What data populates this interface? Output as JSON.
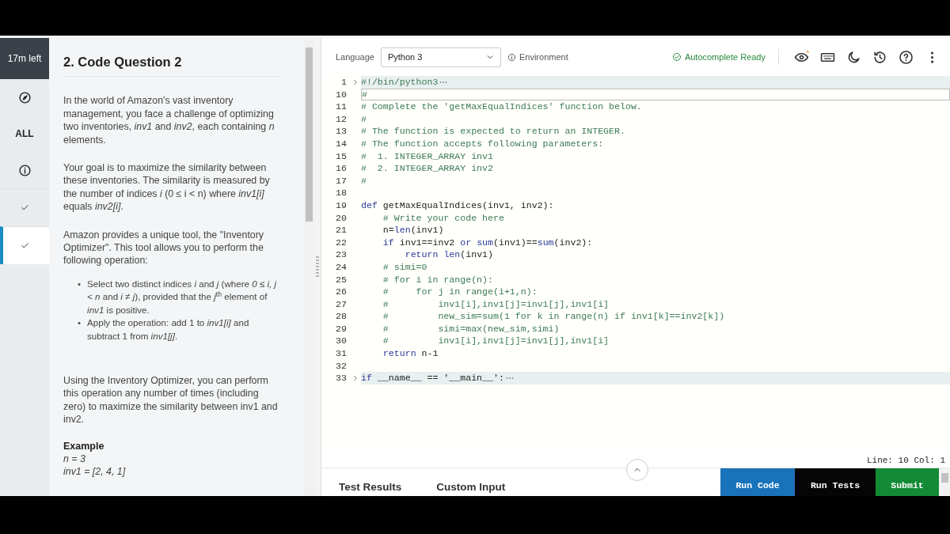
{
  "timer": "17m left",
  "nav": [
    {
      "kind": "compass",
      "selected": false
    },
    {
      "kind": "text",
      "label": "ALL",
      "selected": false
    },
    {
      "kind": "info",
      "selected": false
    },
    {
      "kind": "check",
      "selected": false
    },
    {
      "kind": "check",
      "selected": true
    }
  ],
  "question": {
    "title": "2. Code Question 2",
    "blocks": [
      {
        "kind": "para",
        "text": "In the world of Amazon's vast inventory management, you face a challenge of optimizing two inventories, *inv1* and *inv2*, each containing *n* elements."
      },
      {
        "kind": "para",
        "text": "Your goal is to maximize the similarity between these inventories. The similarity is measured by the number of indices *i* (0 ≤ i < n) where *inv1[i]* equals *inv2[i]*."
      },
      {
        "kind": "para",
        "text": "Amazon provides a unique tool, the \"Inventory Optimizer\". This tool allows you to perform the following operation:"
      },
      {
        "kind": "bullets",
        "items": [
          {
            "marker": "•",
            "text": "Select two distinct indices *i* and *j* (where *0 ≤ i, j < n* and *i ≠ j*), provided that the *j*$^{th}$ element of *inv1* is positive."
          },
          {
            "marker": "•",
            "text": "Apply the operation: add 1 to *inv1[i]* and subtract 1 from *inv1[j]*."
          }
        ]
      },
      {
        "kind": "gap"
      },
      {
        "kind": "para",
        "text": "Using the Inventory Optimizer, you can perform this operation any number of times (including zero) to maximize the similarity between inv1 and inv2."
      },
      {
        "kind": "heading",
        "text": "Example"
      },
      {
        "kind": "example",
        "text": "n = 3"
      },
      {
        "kind": "example",
        "text": "inv1 = [2, 4, 1]"
      }
    ]
  },
  "editor": {
    "language_label": "Language",
    "language": "Python 3",
    "environment": "Environment",
    "autocomplete": "Autocomplete Ready",
    "lines": [
      {
        "num": "1",
        "kind": "comment",
        "text": "#!/bin/python3",
        "folded": true,
        "current": false
      },
      {
        "num": "10",
        "kind": "comment",
        "text": "#",
        "folded": false,
        "current": true
      },
      {
        "num": "11",
        "kind": "comment",
        "text": "# Complete the 'getMaxEqualIndices' function below.",
        "folded": false,
        "current": false
      },
      {
        "num": "12",
        "kind": "comment",
        "text": "#",
        "folded": false,
        "current": false
      },
      {
        "num": "13",
        "kind": "comment",
        "text": "# The function is expected to return an INTEGER.",
        "folded": false,
        "current": false
      },
      {
        "num": "14",
        "kind": "comment",
        "text": "# The function accepts following parameters:",
        "folded": false,
        "current": false
      },
      {
        "num": "15",
        "kind": "comment",
        "text": "#  1. INTEGER_ARRAY inv1",
        "folded": false,
        "current": false
      },
      {
        "num": "16",
        "kind": "comment",
        "text": "#  2. INTEGER_ARRAY inv2",
        "folded": false,
        "current": false
      },
      {
        "num": "17",
        "kind": "comment",
        "text": "#",
        "folded": false,
        "current": false
      },
      {
        "num": "18",
        "kind": "blank",
        "folded": false,
        "current": false
      },
      {
        "num": "19",
        "kind": "code",
        "text": "def getMaxEqualIndices(inv1, inv2):",
        "folded": false,
        "current": false
      },
      {
        "num": "20",
        "kind": "comment",
        "text": "    # Write your code here",
        "folded": false,
        "current": false
      },
      {
        "num": "21",
        "kind": "code",
        "text": "    n=len(inv1)",
        "folded": false,
        "current": false
      },
      {
        "num": "22",
        "kind": "code",
        "text": "    if inv1==inv2 or sum(inv1)==sum(inv2):",
        "folded": false,
        "current": false
      },
      {
        "num": "23",
        "kind": "code",
        "text": "        return len(inv1)",
        "folded": false,
        "current": false
      },
      {
        "num": "24",
        "kind": "comment",
        "text": "    # simi=0",
        "folded": false,
        "current": false
      },
      {
        "num": "25",
        "kind": "comment",
        "text": "    # for i in range(n):",
        "folded": false,
        "current": false
      },
      {
        "num": "26",
        "kind": "comment",
        "text": "    #     for j in range(i+1,n):",
        "folded": false,
        "current": false
      },
      {
        "num": "27",
        "kind": "comment",
        "text": "    #         inv1[i],inv1[j]=inv1[j],inv1[i]",
        "folded": false,
        "current": false
      },
      {
        "num": "28",
        "kind": "comment",
        "text": "    #         new_sim=sum(1 for k in range(n) if inv1[k]==inv2[k])",
        "folded": false,
        "current": false
      },
      {
        "num": "29",
        "kind": "comment",
        "text": "    #         simi=max(new_sim,simi)",
        "folded": false,
        "current": false
      },
      {
        "num": "30",
        "kind": "comment",
        "text": "    #         inv1[i],inv1[j]=inv1[j],inv1[i]",
        "folded": false,
        "current": false
      },
      {
        "num": "31",
        "kind": "code",
        "text": "    return n-1",
        "folded": false,
        "current": false
      },
      {
        "num": "32",
        "kind": "blank",
        "folded": false,
        "current": false
      },
      {
        "num": "33",
        "kind": "code",
        "text": "if __name__ == '__main__':",
        "folded": true,
        "current": false
      }
    ],
    "position": "Line: 10 Col: 1"
  },
  "bottom_tabs": [
    "Test Results",
    "Custom Input"
  ],
  "buttons": [
    {
      "kind": "run",
      "label": "Run Code"
    },
    {
      "kind": "tests",
      "label": "Run Tests"
    },
    {
      "kind": "submit",
      "label": "Submit"
    }
  ]
}
